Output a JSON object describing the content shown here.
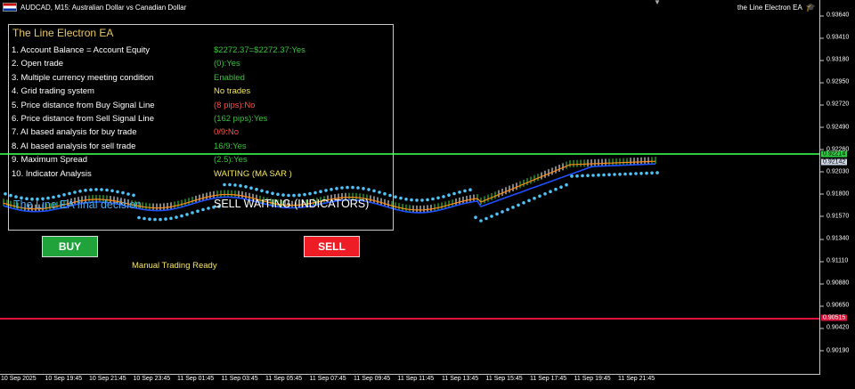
{
  "header": {
    "title": "AUDCAD, M15:  Australian Dollar vs Canadian Dollar",
    "ea_name": "the Line Electron EA"
  },
  "price_axis": {
    "ticks": [
      "0.93640",
      "0.93410",
      "0.93180",
      "0.92950",
      "0.92720",
      "0.92490",
      "0.92260",
      "0.92030",
      "0.91800",
      "0.91570",
      "0.91340",
      "0.91110",
      "0.90880",
      "0.90650",
      "0.90420",
      "0.90190"
    ],
    "green_level": "0.92214",
    "blue_level": "0.92142",
    "red_level": "0.90515"
  },
  "time_axis": {
    "ticks": [
      "10 Sep 2025",
      "10 Sep 19:45",
      "10 Sep 21:45",
      "10 Sep 23:45",
      "11 Sep 01:45",
      "11 Sep 03:45",
      "11 Sep 05:45",
      "11 Sep 07:45",
      "11 Sep 09:45",
      "11 Sep 11:45",
      "11 Sep 13:45",
      "11 Sep 15:45",
      "11 Sep 17:45",
      "11 Sep 19:45",
      "11 Sep 21:45"
    ]
  },
  "panel": {
    "title": "The Line Electron EA",
    "rows": [
      {
        "label": "1. Account Balance = Account Equity",
        "value": "$2272.37=$2272.37:Yes",
        "color": "#39c339"
      },
      {
        "label": "2. Open trade",
        "value": "(0):Yes",
        "color": "#39c339"
      },
      {
        "label": "3. Multiple currency meeting condition",
        "value": "Enabled",
        "color": "#39c339"
      },
      {
        "label": "4. Grid trading system",
        "value": "No trades",
        "color": "#f5e663"
      },
      {
        "label": "5. Price distance from Buy Signal Line",
        "value": "(8 pips):No",
        "color": "#ff5040"
      },
      {
        "label": "6. Price distance from Sell Signal Line",
        "value": "(162 pips):Yes",
        "color": "#39c339"
      },
      {
        "label": "7. AI based analysis for buy trade",
        "value": "0/9:No",
        "color": "#ff5040"
      },
      {
        "label": "8. AI based analysis for sell trade",
        "value": "16/9:Yes",
        "color": "#39c339"
      },
      {
        "label": "9. Maximum Spread",
        "value": "(2.5):Yes",
        "color": "#39c339"
      },
      {
        "label": "10. Indicator Analysis",
        "value": "WAITING (MA SAR )",
        "color": "#f5e663"
      }
    ],
    "decision_label": "The Line EA final decision",
    "decision_value": "SELL WAITING (INDICATORS)"
  },
  "buttons": {
    "buy": "BUY",
    "sell": "SELL"
  },
  "status": "Manual Trading Ready",
  "colors": {
    "green_line": "#2ecc40",
    "red_line": "#dc143c",
    "sar": "#4fc3f7",
    "ma_fast": "#ff8c1a",
    "ma_slow": "#1e50ff"
  }
}
